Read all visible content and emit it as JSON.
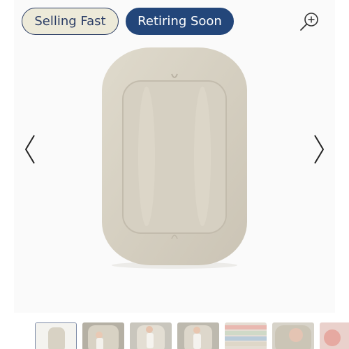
{
  "badges": {
    "selling_fast": "Selling Fast",
    "retiring_soon": "Retiring Soon"
  },
  "icons": {
    "zoom": "zoom-in-icon",
    "prev": "chevron-left-icon",
    "next": "chevron-right-icon"
  },
  "colors": {
    "selling_fast_bg": "#edead9",
    "retiring_soon_bg": "#23467a",
    "navy": "#2c3e66",
    "lounger": "#d8d2c4"
  },
  "carousel": {
    "thumbnail_count": 7,
    "active_index": 0
  }
}
